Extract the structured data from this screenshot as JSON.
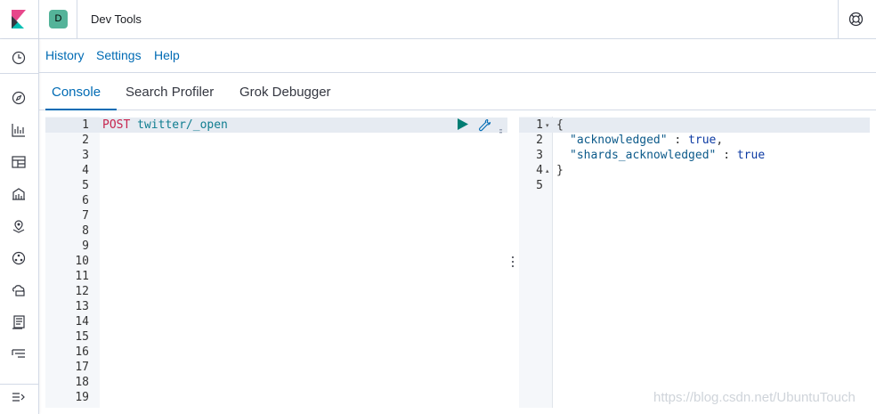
{
  "header": {
    "space_initial": "D",
    "app_title": "Dev Tools"
  },
  "top_menu": {
    "history": "History",
    "settings": "Settings",
    "help": "Help"
  },
  "tabs": [
    {
      "label": "Console",
      "active": true
    },
    {
      "label": "Search Profiler",
      "active": false
    },
    {
      "label": "Grok Debugger",
      "active": false
    }
  ],
  "request_editor": {
    "line_numbers": [
      "1",
      "2",
      "3",
      "4",
      "5",
      "6",
      "7",
      "8",
      "9",
      "10",
      "11",
      "12",
      "13",
      "14",
      "15",
      "16",
      "17",
      "18",
      "19"
    ],
    "method": "POST",
    "path": "twitter/_open"
  },
  "response_editor": {
    "line_numbers": [
      "1",
      "2",
      "3",
      "4",
      "5"
    ],
    "line1": "{",
    "key1": "\"acknowledged\"",
    "sep1": " : ",
    "val1": "true",
    "comma1": ",",
    "key2": "\"shards_acknowledged\"",
    "sep2": " : ",
    "val2": "true",
    "line4": "}"
  },
  "watermark": "https://blog.csdn.net/UbuntuTouch",
  "colors": {
    "accent": "#006bb4",
    "space_avatar": "#54b399",
    "method": "#c7254e",
    "play_button": "#017d73"
  }
}
